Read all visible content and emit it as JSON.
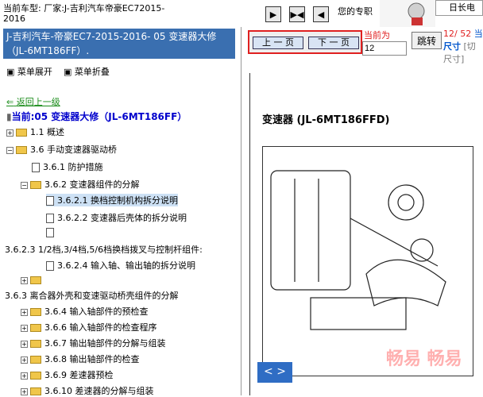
{
  "topbar": {
    "cartype_line1": "当前车型:   厂家:J-吉利汽车帝豪EC72015-",
    "cartype_line2": "2016",
    "nav1": "▶",
    "nav2": "▶◀",
    "nav3": "◀",
    "welcome": "您的专职",
    "chat": "日长电"
  },
  "left": {
    "title": "J-吉利汽车-帝豪EC7-2015-2016- 05 变速器大修（JL-6MT186FF）.",
    "expand_all": "菜单展开",
    "collapse_all": "菜单折叠",
    "back": "返回上一级",
    "current": "当前:05 变速器大修（JL-6MT186FF）",
    "tree": [
      {
        "label": "1.1 概述"
      },
      {
        "label": "3.6 手动变速器驱动桥"
      },
      {
        "label": "3.6.1 防护措施"
      },
      {
        "label": "3.6.2 变速器组件的分解"
      },
      {
        "label": "3.6.2.1 换档控制机构拆分说明"
      },
      {
        "label": "3.6.2.2 变速器后壳体的拆分说明"
      },
      {
        "label": ""
      },
      {
        "label": "3.6.2.3 1/2档,3/4档,5/6档换档拨叉与控制杆组件:"
      },
      {
        "label": "3.6.2.4 输入轴、输出轴的拆分说明"
      },
      {
        "label": ""
      },
      {
        "label": "3.6.3 离合器外壳和变速驱动桥壳组件的分解"
      },
      {
        "label": "3.6.4 输入轴部件的预检查"
      },
      {
        "label": "3.6.6 输入轴部件的检查程序"
      },
      {
        "label": "3.6.7 输出轴部件的分解与组装"
      },
      {
        "label": "3.6.8 输出轴部件的检查"
      },
      {
        "label": "3.6.9 差速器预检"
      },
      {
        "label": "3.6.10 差速器的分解与组装"
      }
    ]
  },
  "right": {
    "prev": "上 一 页",
    "next": "下 一 页",
    "current_label": "当前为",
    "page_value": "12",
    "jump": "跳转",
    "page_total": "12/ 52",
    "page_cur": "当",
    "size_label": "尺寸",
    "size_label2": "尺寸]",
    "size_bracket": "[切",
    "section_title": "变速器  (JL-6MT186FFD)",
    "arrow_button": "< >",
    "watermark": "畅易 畅易"
  }
}
